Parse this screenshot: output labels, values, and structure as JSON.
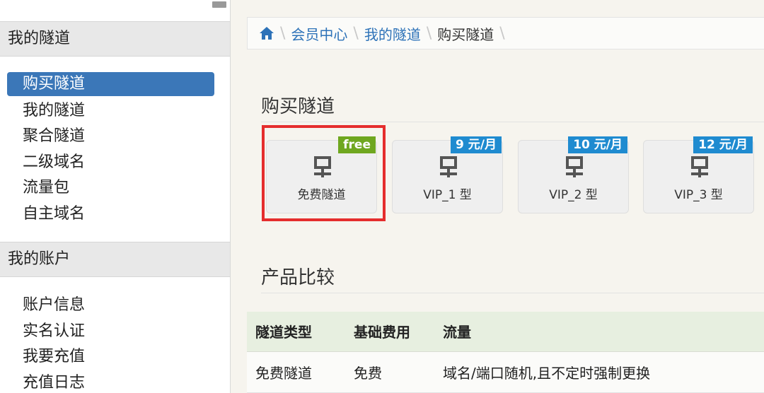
{
  "sidebar": {
    "section1": {
      "title": "我的隧道",
      "items": [
        {
          "label": "购买隧道",
          "active": true
        },
        {
          "label": "我的隧道"
        },
        {
          "label": "聚合隧道"
        },
        {
          "label": "二级域名"
        },
        {
          "label": "流量包"
        },
        {
          "label": "自主域名"
        }
      ]
    },
    "section2": {
      "title": "我的账户",
      "items": [
        {
          "label": "账户信息"
        },
        {
          "label": "实名认证"
        },
        {
          "label": "我要充值"
        },
        {
          "label": "充值日志"
        }
      ]
    }
  },
  "breadcrumb": {
    "home_icon": "home-icon",
    "items": [
      "会员中心",
      "我的隧道",
      "购买隧道"
    ]
  },
  "purchase": {
    "title": "购买隧道",
    "plans": [
      {
        "label": "免费隧道",
        "badge": "free",
        "badge_color": "#6fa71f"
      },
      {
        "label": "VIP_1 型",
        "badge": "9 元/月",
        "badge_color": "#1f8bd0"
      },
      {
        "label": "VIP_2 型",
        "badge": "10 元/月",
        "badge_color": "#1f8bd0"
      },
      {
        "label": "VIP_3 型",
        "badge": "12 元/月",
        "badge_color": "#1f8bd0"
      }
    ]
  },
  "compare": {
    "title": "产品比较",
    "headers": [
      "隧道类型",
      "基础费用",
      "流量"
    ],
    "rows": [
      [
        "免费隧道",
        "免费",
        "域名/端口随机,且不定时强制更换"
      ]
    ]
  },
  "colors": {
    "accent": "#3b77b8",
    "link": "#2d72b8",
    "highlight": "#e52d2d",
    "badge_green": "#6fa71f",
    "badge_blue": "#1f8bd0"
  }
}
